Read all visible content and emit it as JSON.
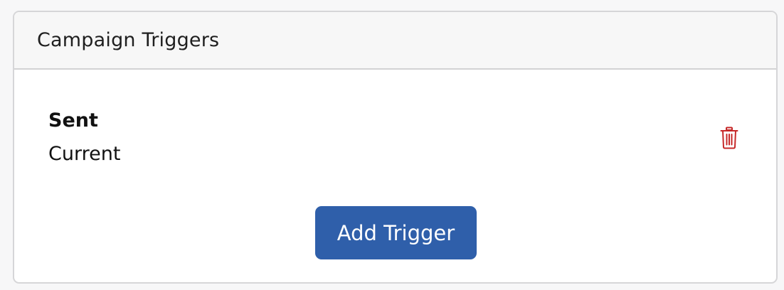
{
  "panel": {
    "title": "Campaign Triggers"
  },
  "triggers": [
    {
      "name": "Sent",
      "status": "Current",
      "delete_icon": "trash-icon"
    }
  ],
  "actions": {
    "add_trigger_label": "Add Trigger"
  },
  "colors": {
    "primary_button": "#2f5faa",
    "delete_icon": "#c62828",
    "header_background": "#f7f7f7",
    "border": "#d6d6d8"
  }
}
